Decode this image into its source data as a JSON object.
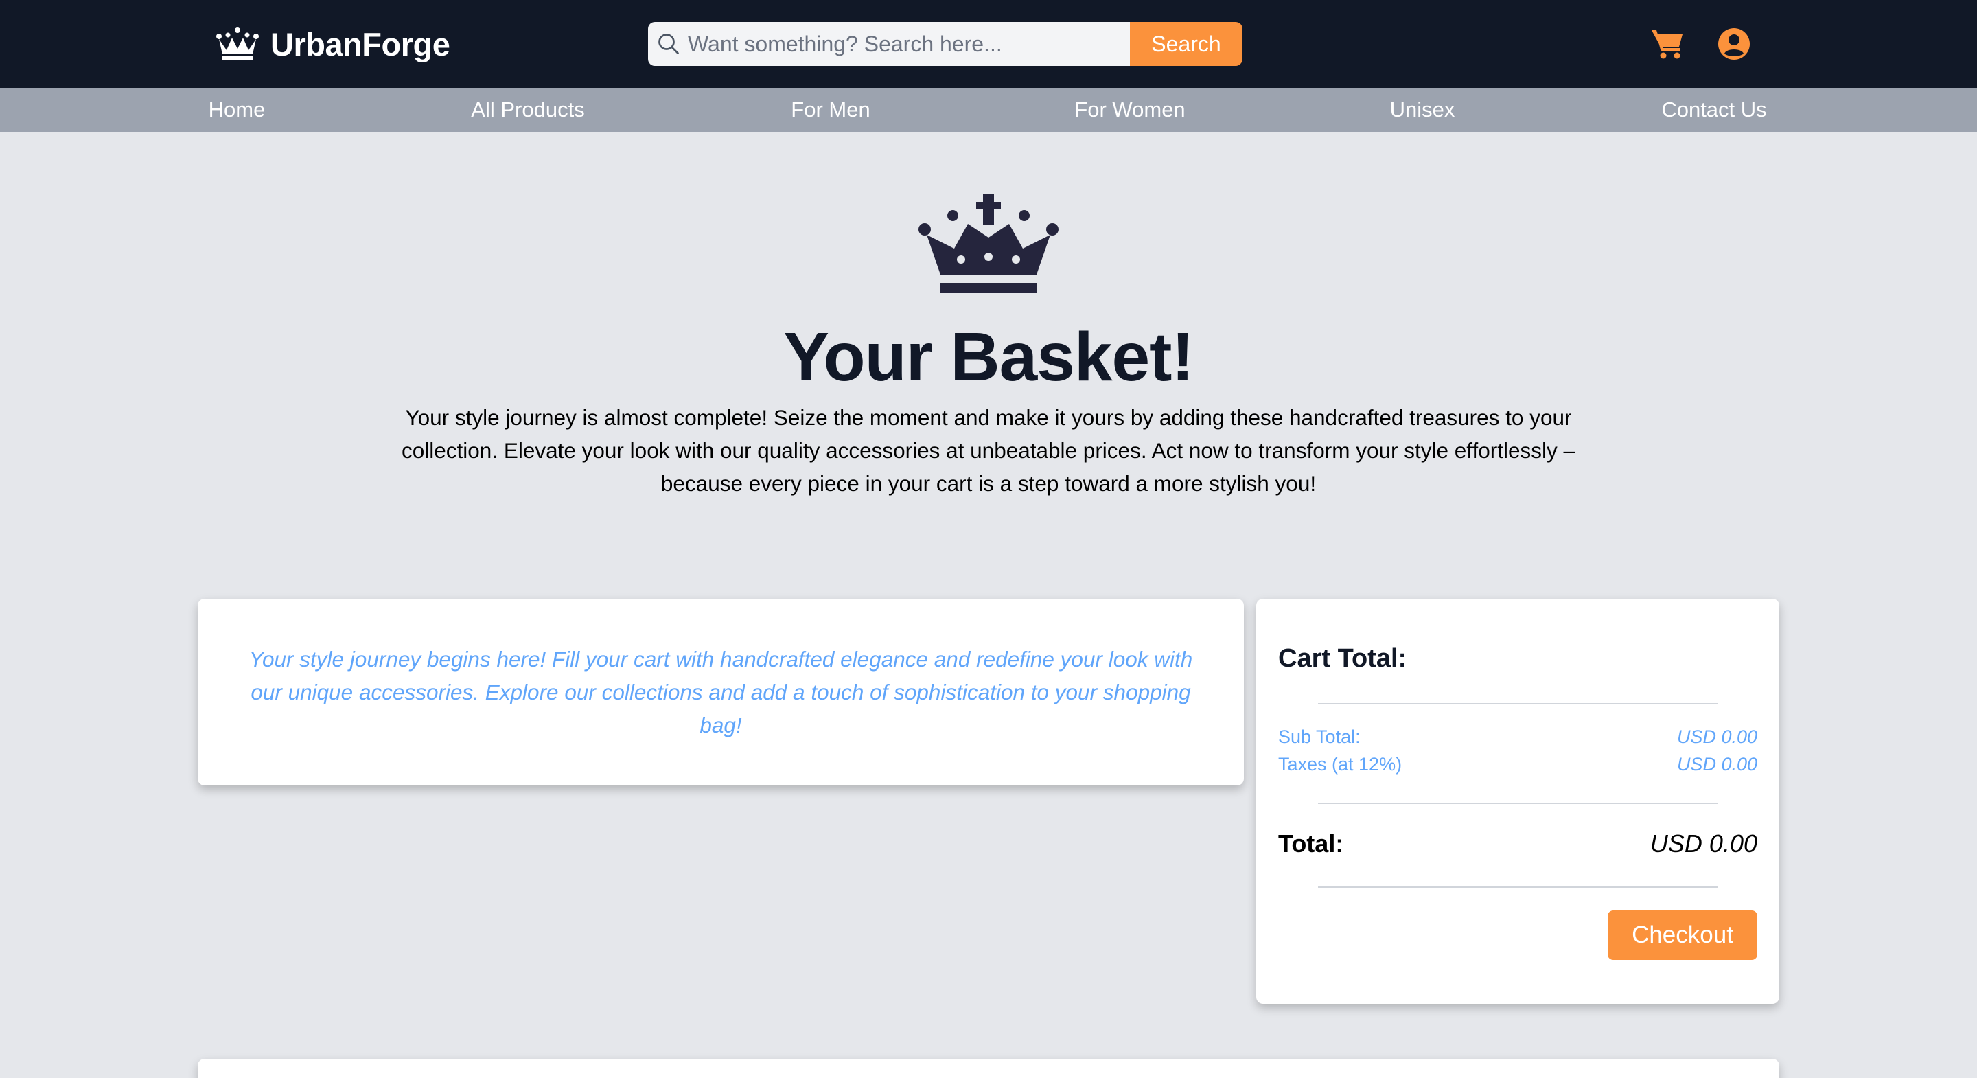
{
  "header": {
    "brand_name": "UrbanForge",
    "search_placeholder": "Want something? Search here...",
    "search_button": "Search",
    "cart_icon": "cart-icon",
    "account_icon": "user-circle-icon"
  },
  "nav": {
    "items": [
      "Home",
      "All Products",
      "For Men",
      "For Women",
      "Unisex",
      "Contact Us"
    ]
  },
  "hero": {
    "title": "Your Basket!",
    "intro": "Your style journey is almost complete! Seize the moment and make it yours by adding these handcrafted treasures to your collection. Elevate your look with our quality accessories at unbeatable prices. Act now to transform your style effortlessly – because every piece in your cart is a step toward a more stylish you!"
  },
  "cart": {
    "empty_message": "Your style journey begins here! Fill your cart with handcrafted elegance and redefine your look with our unique accessories. Explore our collections and add a touch of sophistication to your shopping bag!"
  },
  "summary": {
    "title": "Cart Total:",
    "subtotal_label": "Sub Total:",
    "subtotal_value": "USD 0.00",
    "tax_label": "Taxes (at 12%)",
    "tax_value": "USD 0.00",
    "total_label": "Total:",
    "total_value": "USD 0.00",
    "checkout_button": "Checkout"
  },
  "colors": {
    "header_bg": "#111827",
    "nav_bg": "#9ca3af",
    "page_bg": "#e5e7eb",
    "accent": "#fb923c",
    "muted_blue": "#60a5fa"
  }
}
